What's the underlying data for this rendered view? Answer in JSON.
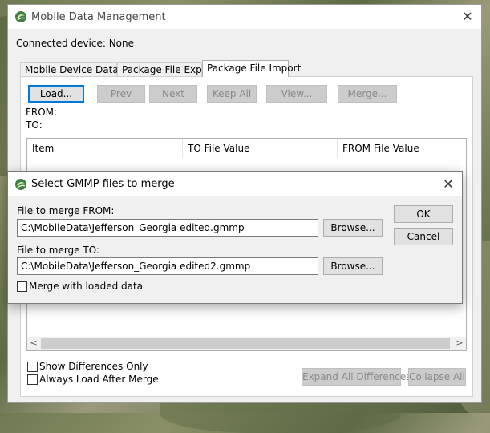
{
  "window": {
    "title": "Mobile Data Management",
    "connected_device": "Connected device: None"
  },
  "tabs": [
    {
      "label": "Mobile Device Data Link",
      "active": false
    },
    {
      "label": "Package File Export",
      "active": false
    },
    {
      "label": "Package File Import",
      "active": true
    }
  ],
  "toolbar": {
    "load": "Load...",
    "prev": "Prev",
    "next": "Next",
    "keep_all": "Keep All",
    "view": "View...",
    "merge": "Merge..."
  },
  "from_label": "FROM:",
  "to_label": "TO:",
  "list": {
    "columns": [
      "Item",
      "TO File Value",
      "FROM File Value"
    ]
  },
  "options": {
    "show_differences_only": "Show Differences Only",
    "always_load_after_merge": "Always Load After Merge"
  },
  "bottom_buttons": {
    "expand_all": "Expand All Differences",
    "collapse_all": "Collapse All"
  },
  "dialog": {
    "title": "Select GMMP files to merge",
    "from_label": "File to merge FROM:",
    "from_value": "C:\\MobileData\\Jefferson_Georgia edited.gmmp",
    "to_label": "File to merge TO:",
    "to_value": "C:\\MobileData\\Jefferson_Georgia edited2.gmmp",
    "browse": "Browse...",
    "merge_loaded": "Merge with loaded data",
    "ok": "OK",
    "cancel": "Cancel"
  },
  "colors": {
    "accent": "#0078d7",
    "background": "#f0f0f0"
  }
}
